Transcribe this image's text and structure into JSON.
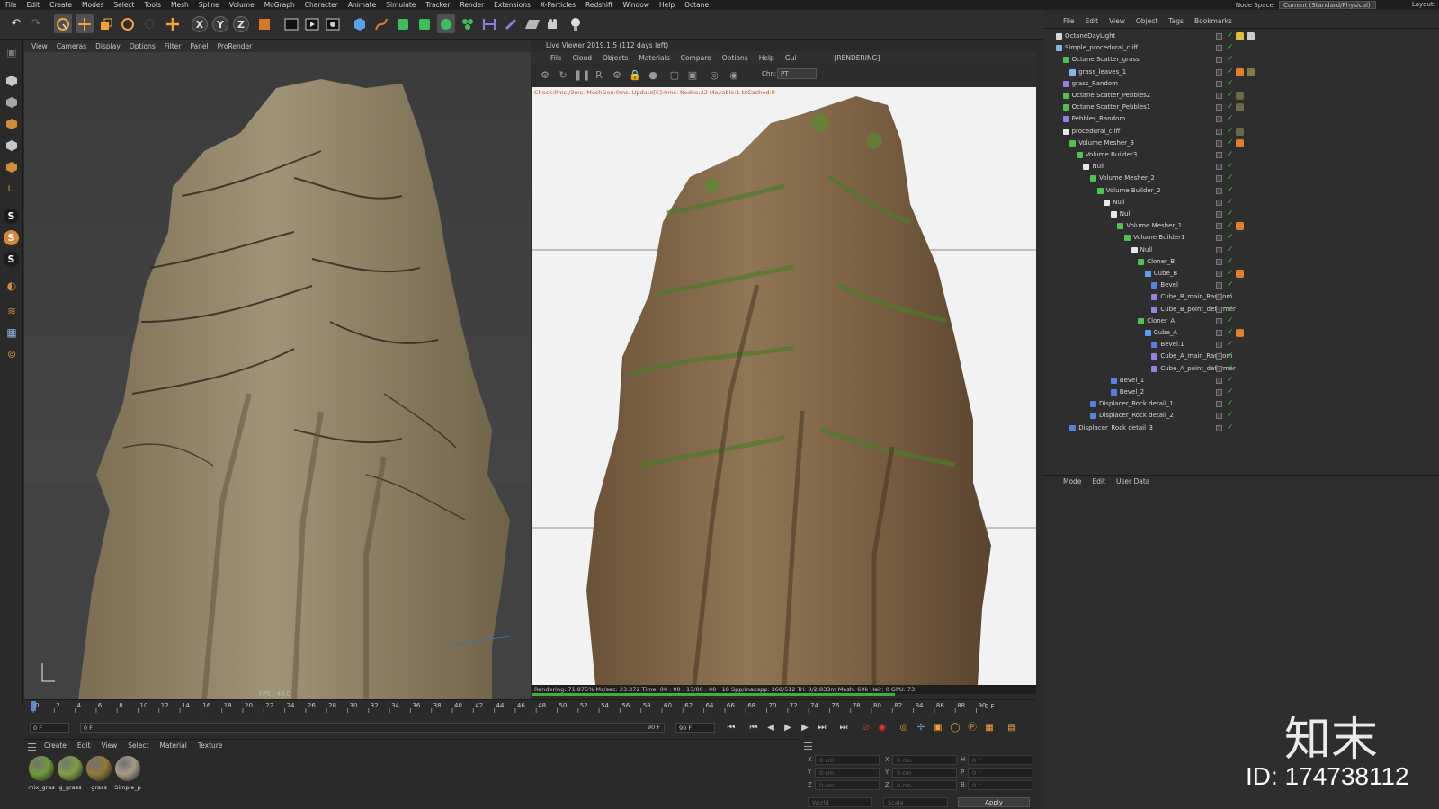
{
  "menubar": [
    "File",
    "Edit",
    "Create",
    "Modes",
    "Select",
    "Tools",
    "Mesh",
    "Spline",
    "Volume",
    "MoGraph",
    "Character",
    "Animate",
    "Simulate",
    "Tracker",
    "Render",
    "Extensions",
    "X-Particles",
    "Redshift",
    "Window",
    "Help",
    "Octane"
  ],
  "node_space": {
    "label": "Node Space:",
    "value": "Current (Standard/Physical)"
  },
  "layout_label": "Layout:",
  "toolbar_axes": [
    "X",
    "Y",
    "Z"
  ],
  "left_tools_s": [
    "S",
    "S",
    "S"
  ],
  "viewport1": {
    "menu": [
      "View",
      "Cameras",
      "Display",
      "Options",
      "Filter",
      "Panel",
      "ProRender"
    ],
    "fps": "FPS : 40.0"
  },
  "live_viewer": {
    "title": "Live Viewer 2019.1.5 (112 days left)",
    "menu": [
      "File",
      "Cloud",
      "Objects",
      "Materials",
      "Compare",
      "Options",
      "Help",
      "Gui"
    ],
    "state": "[RENDERING]",
    "channel_label": "Chn:",
    "channel_value": "PT",
    "status": "Check:0ms./3ms. MeshGen:0ms. Update[C]:0ms. Nodes:22 Movable:1 txCached:0",
    "render_bar": "Rendering: 71.875%  Ms/sec: 23.372   Time: 00 : 00 : 13/00 : 00 : 18  Spp/maxspp: 368/512  Tri: 0/2.833m  Mesh: 69k  Hair: 0    GPU:    73",
    "progress": 0.71875
  },
  "timeline": {
    "ticks": [
      "0",
      "2",
      "4",
      "6",
      "8",
      "10",
      "12",
      "14",
      "16",
      "18",
      "20",
      "22",
      "24",
      "26",
      "28",
      "30",
      "32",
      "34",
      "36",
      "38",
      "40",
      "42",
      "44",
      "46",
      "48",
      "50",
      "52",
      "54",
      "56",
      "58",
      "60",
      "62",
      "64",
      "66",
      "68",
      "70",
      "72",
      "74",
      "76",
      "78",
      "80",
      "82",
      "84",
      "86",
      "88",
      "90"
    ],
    "current": "0 F"
  },
  "transport": {
    "start": "0 F",
    "current": "0 F",
    "end": "90 F",
    "max": "90 F"
  },
  "material_manager": {
    "menu": [
      "Create",
      "Edit",
      "View",
      "Select",
      "Material",
      "Texture"
    ],
    "materials": [
      {
        "label": "mix_gras",
        "color": "#6f9a3a"
      },
      {
        "label": "g_grass",
        "color": "#7fa044"
      },
      {
        "label": "grass",
        "color": "#8e7a3c"
      },
      {
        "label": "Simple_p",
        "color": "#a89b82"
      }
    ]
  },
  "coords": {
    "rows": [
      {
        "a": "X",
        "av": "0 cm",
        "b": "X",
        "bv": "0 cm",
        "c": "H",
        "cv": "0 °"
      },
      {
        "a": "Y",
        "av": "0 cm",
        "b": "Y",
        "bv": "0 cm",
        "c": "P",
        "cv": "0 °"
      },
      {
        "a": "Z",
        "av": "0 cm",
        "b": "Z",
        "bv": "0 cm",
        "c": "B",
        "cv": "0 °"
      }
    ],
    "mode1": "World",
    "mode2": "Scale",
    "apply": "Apply"
  },
  "object_manager": {
    "menu": [
      "File",
      "Edit",
      "View",
      "Object",
      "Tags",
      "Bookmarks"
    ],
    "objects": [
      {
        "name": "OctaneDayLight",
        "depth": 0,
        "color": "#d8d8d8"
      },
      {
        "name": "Simple_procedural_cliff",
        "depth": 0,
        "color": "#8ab4e8"
      },
      {
        "name": "Octane Scatter_grass",
        "depth": 1,
        "color": "#4fc24f"
      },
      {
        "name": "grass_leaves_1",
        "depth": 2,
        "color": "#8ab4e8"
      },
      {
        "name": "grass_Random",
        "depth": 1,
        "color": "#9a7fe0"
      },
      {
        "name": "Octane Scatter_Pebbles2",
        "depth": 1,
        "color": "#4fc24f"
      },
      {
        "name": "Octane Scatter_Pebbles1",
        "depth": 1,
        "color": "#4fc24f"
      },
      {
        "name": "Pebbles_Random",
        "depth": 1,
        "color": "#9a7fe0"
      },
      {
        "name": "procedural_cliff",
        "depth": 1,
        "color": "#e8e8e8"
      },
      {
        "name": "Volume Mesher_3",
        "depth": 2,
        "color": "#4fc24f"
      },
      {
        "name": "Volume Builder3",
        "depth": 3,
        "color": "#4fc24f"
      },
      {
        "name": "Null",
        "depth": 4,
        "color": "#e8e8e8"
      },
      {
        "name": "Volume Mesher_2",
        "depth": 5,
        "color": "#4fc24f"
      },
      {
        "name": "Volume Builder_2",
        "depth": 6,
        "color": "#4fc24f"
      },
      {
        "name": "Null",
        "depth": 7,
        "color": "#e8e8e8"
      },
      {
        "name": "Null",
        "depth": 8,
        "color": "#e8e8e8"
      },
      {
        "name": "Volume Mesher_1",
        "depth": 9,
        "color": "#4fc24f"
      },
      {
        "name": "Volume Builder1",
        "depth": 10,
        "color": "#4fc24f"
      },
      {
        "name": "Null",
        "depth": 11,
        "color": "#e8e8e8"
      },
      {
        "name": "Cloner_B",
        "depth": 12,
        "color": "#4fc24f"
      },
      {
        "name": "Cube_B",
        "depth": 13,
        "color": "#5aa0f0"
      },
      {
        "name": "Bevel",
        "depth": 14,
        "color": "#5a7fe0"
      },
      {
        "name": "Cube_B_main_Random",
        "depth": 14,
        "color": "#9a7fe0"
      },
      {
        "name": "Cube_B_point_deformer",
        "depth": 14,
        "color": "#9a7fe0"
      },
      {
        "name": "Cloner_A",
        "depth": 12,
        "color": "#4fc24f"
      },
      {
        "name": "Cube_A",
        "depth": 13,
        "color": "#5aa0f0"
      },
      {
        "name": "Bevel.1",
        "depth": 14,
        "color": "#5a7fe0"
      },
      {
        "name": "Cube_A_main_Random",
        "depth": 14,
        "color": "#9a7fe0"
      },
      {
        "name": "Cube_A_point_deformer",
        "depth": 14,
        "color": "#9a7fe0"
      },
      {
        "name": "Bevel_1",
        "depth": 8,
        "color": "#5a7fe0"
      },
      {
        "name": "Bevel_2",
        "depth": 8,
        "color": "#5a7fe0"
      },
      {
        "name": "Displacer_Rock detail_1",
        "depth": 5,
        "color": "#5a7fe0"
      },
      {
        "name": "Displacer_Rock detail_2",
        "depth": 5,
        "color": "#5a7fe0"
      },
      {
        "name": "Displacer_Rock detail_3",
        "depth": 2,
        "color": "#5a7fe0"
      }
    ]
  },
  "attributes": {
    "menu": [
      "Mode",
      "Edit",
      "User Data"
    ]
  },
  "watermark": {
    "logo": "知末",
    "id": "ID: 174738112"
  }
}
